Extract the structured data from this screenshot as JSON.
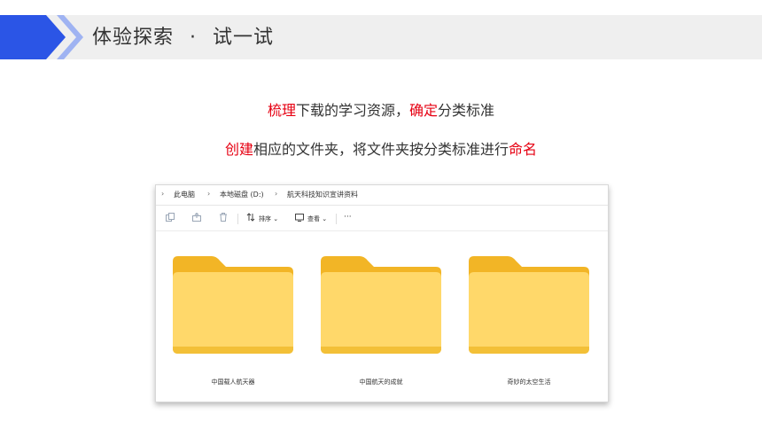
{
  "slide": {
    "title": "体验探索",
    "separator": "·",
    "subtitle": "试一试"
  },
  "instructions": {
    "line1": {
      "hl1": "梳理",
      "mid": "下载的学习资源，",
      "hl2": "确定",
      "end": "分类标准"
    },
    "line2": {
      "hl1": "创建",
      "mid": "相应的文件夹，将文件夹按分类标准进行",
      "hl2": "命名"
    }
  },
  "explorer": {
    "breadcrumb": [
      "此电脑",
      "本地磁盘 (D:)",
      "航天科技知识宣讲资料"
    ],
    "toolbar": {
      "sort_label": "排序",
      "view_label": "查看",
      "more_label": "···"
    },
    "folders": [
      {
        "name": "中国载人航天器"
      },
      {
        "name": "中国航天的成就"
      },
      {
        "name": "奇妙的太空生活"
      }
    ]
  },
  "colors": {
    "highlight": "#e60012",
    "accent_blue": "#2b55e6",
    "folder_yellow": "#ffd34f"
  }
}
